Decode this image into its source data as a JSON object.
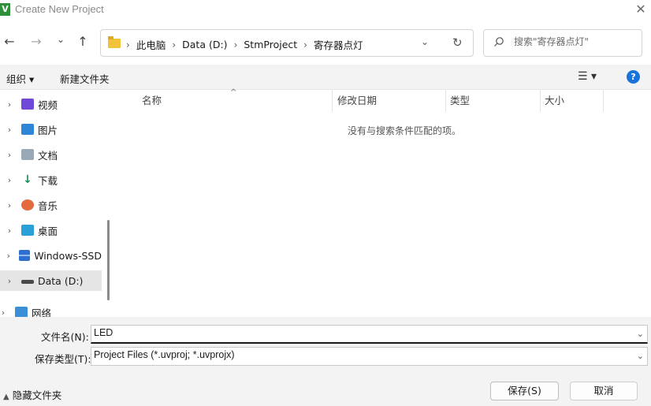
{
  "window": {
    "app_icon_letter": "V",
    "title": "Create New Project",
    "close_glyph": "✕"
  },
  "nav": {
    "back_glyph": "←",
    "forward_glyph": "→",
    "recent_glyph": "⌄",
    "up_glyph": "↑",
    "breadcrumbs": [
      "此电脑",
      "Data (D:)",
      "StmProject",
      "寄存器点灯"
    ],
    "crumb_separator": "›",
    "address_dropdown_glyph": "⌄",
    "refresh_glyph": "↻",
    "search_placeholder": "搜索\"寄存器点灯\""
  },
  "toolbar": {
    "organize_label": "组织 ▾",
    "new_folder_label": "新建文件夹",
    "view_glyph": "☰ ▾",
    "help_glyph": "?"
  },
  "sidebar": {
    "chevron": "›",
    "items": [
      {
        "label": "视频",
        "icon": "video-icon"
      },
      {
        "label": "图片",
        "icon": "pictures-icon"
      },
      {
        "label": "文档",
        "icon": "documents-icon"
      },
      {
        "label": "下载",
        "icon": "download-icon",
        "glyph": "↓"
      },
      {
        "label": "音乐",
        "icon": "music-icon"
      },
      {
        "label": "桌面",
        "icon": "desktop-icon"
      },
      {
        "label": "Windows-SSD",
        "icon": "ssd-drive-icon"
      },
      {
        "label": "Data (D:)",
        "icon": "drive-icon",
        "selected": true
      },
      {
        "label": "网络",
        "icon": "network-icon"
      }
    ]
  },
  "file_list": {
    "columns": [
      "名称",
      "修改日期",
      "类型",
      "大小"
    ],
    "sort_glyph": "^",
    "empty_message": "没有与搜索条件匹配的项。"
  },
  "footer": {
    "filename_label": "文件名(N):",
    "filename_value": "LED",
    "filetype_label": "保存类型(T):",
    "filetype_value": "Project Files (*.uvproj; *.uvprojx)",
    "dropdown_glyph": "⌄",
    "hide_folders_caret": "▲",
    "hide_folders_label": "隐藏文件夹",
    "save_label": "保存(S)",
    "cancel_label": "取消"
  },
  "colors": {
    "folder": "#f1c33b",
    "help_icon": "#1a73d9",
    "selected_row": "#e5e5e5",
    "panel_bg": "#f3f3f3"
  }
}
